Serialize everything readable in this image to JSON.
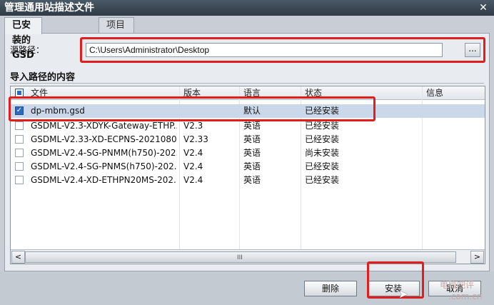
{
  "window": {
    "title": "管理通用站描述文件",
    "close_glyph": "✕"
  },
  "tabs": [
    {
      "label": "已安装的 GSD",
      "active": true
    },
    {
      "label": "项目中的 GSD",
      "active": false
    }
  ],
  "source": {
    "label": "源路径：",
    "path_value": "C:\\Users\\Administrator\\Desktop",
    "browse_label": "..."
  },
  "content_section": {
    "title": "导入路径的内容",
    "columns": [
      "文件",
      "版本",
      "语言",
      "状态",
      "信息"
    ],
    "rows": [
      {
        "checked": true,
        "file": "dp-mbm.gsd",
        "version": "",
        "language": "默认",
        "status": "已经安装",
        "info": ""
      },
      {
        "checked": false,
        "file": "GSDML-V2.3-XDYK-Gateway-ETHP...",
        "version": "V2.3",
        "language": "英语",
        "status": "已经安装",
        "info": ""
      },
      {
        "checked": false,
        "file": "GSDML-V2.33-XD-ECPNS-2021080...",
        "version": "V2.33",
        "language": "英语",
        "status": "已经安装",
        "info": ""
      },
      {
        "checked": false,
        "file": "GSDML-V2.4-SG-PNMM(h750)-202...",
        "version": "V2.4",
        "language": "英语",
        "status": "尚未安装",
        "info": ""
      },
      {
        "checked": false,
        "file": "GSDML-V2.4-SG-PNMS(h750)-202...",
        "version": "V2.4",
        "language": "英语",
        "status": "已经安装",
        "info": ""
      },
      {
        "checked": false,
        "file": "GSDML-V2.4-XD-ETHPN20MS-202...",
        "version": "V2.4",
        "language": "英语",
        "status": "已经安装",
        "info": ""
      }
    ]
  },
  "scrollbar": {
    "left_arrow": "<",
    "right_arrow": ">",
    "grip": "III"
  },
  "buttons": {
    "delete": "删除",
    "install": "安装",
    "cancel": "取消"
  },
  "watermark": {
    "line1": "电脑吧评",
    "line2": ".com.cn"
  },
  "colors": {
    "highlight": "#e21d1d",
    "selected_row": "#cad8ea",
    "checkbox_blue": "#2c6bc0"
  }
}
